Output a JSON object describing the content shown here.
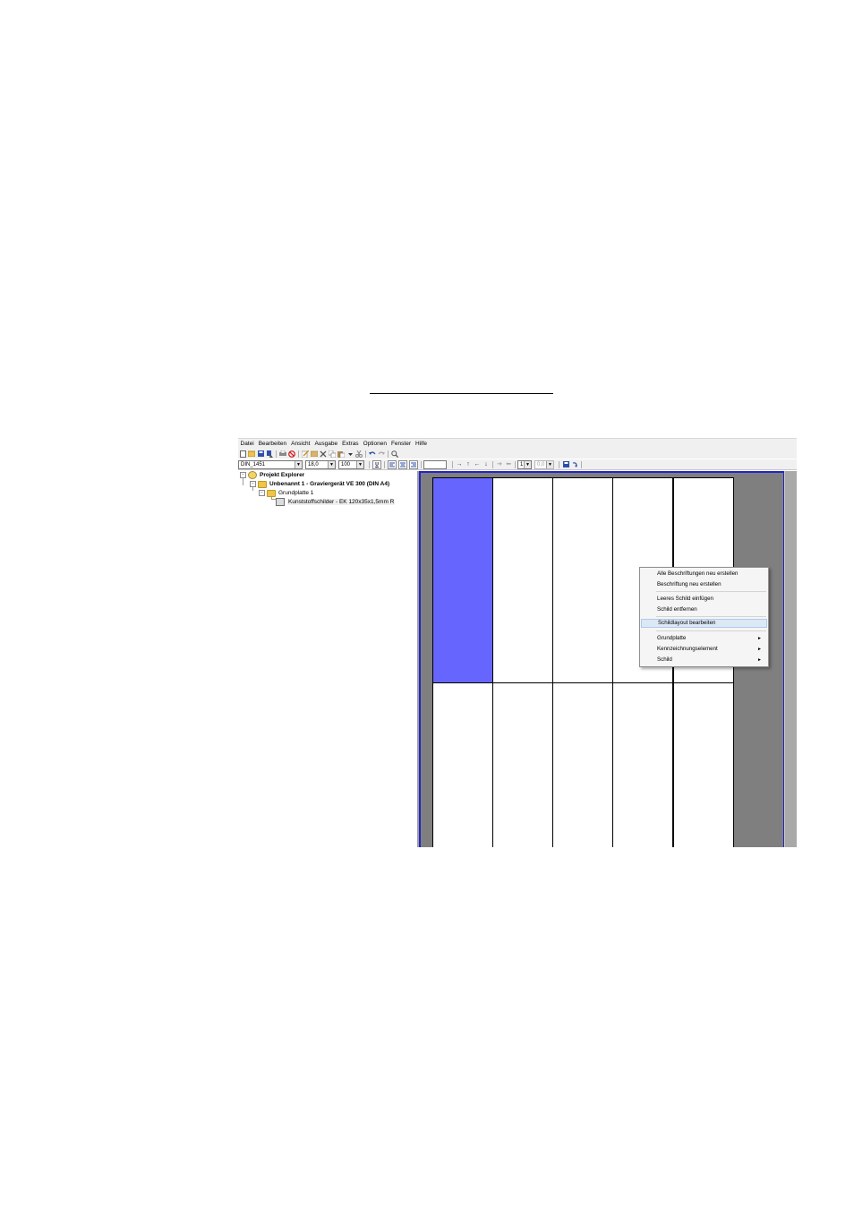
{
  "menubar": {
    "items": [
      "Datei",
      "Bearbeiten",
      "Ansicht",
      "Ausgabe",
      "Extras",
      "Optionen",
      "Fenster",
      "Hilfe"
    ]
  },
  "toolbar2": {
    "font_select": "DIN_1451",
    "font_size": "18,0",
    "scale": "100",
    "underline_label": "U",
    "page_select": "1",
    "value_select": "0,0"
  },
  "tree": {
    "root": "Projekt Explorer",
    "project": "Unbenannt 1 - Graviergerät VE 300 (DIN A4)",
    "plate": "Grundplatte 1",
    "item": "Kunststoffschilder - EK 120x35x1,5mm R"
  },
  "context_menu": {
    "items": [
      "Alle Beschriftungen neu erstellen",
      "Beschriftung neu erstellen",
      "Leeres Schild einfügen",
      "Schild entfernen",
      "Schildlayout bearbeiten",
      "Grundplatte",
      "Kennzeichnungselement",
      "Schild"
    ],
    "highlighted_item": "Schildlayout bearbeiten",
    "submenu_arrow": "►"
  },
  "colors": {
    "selected_label": "#6666ff",
    "workspace": "#7f7f7f",
    "frame": "#2323c8"
  }
}
